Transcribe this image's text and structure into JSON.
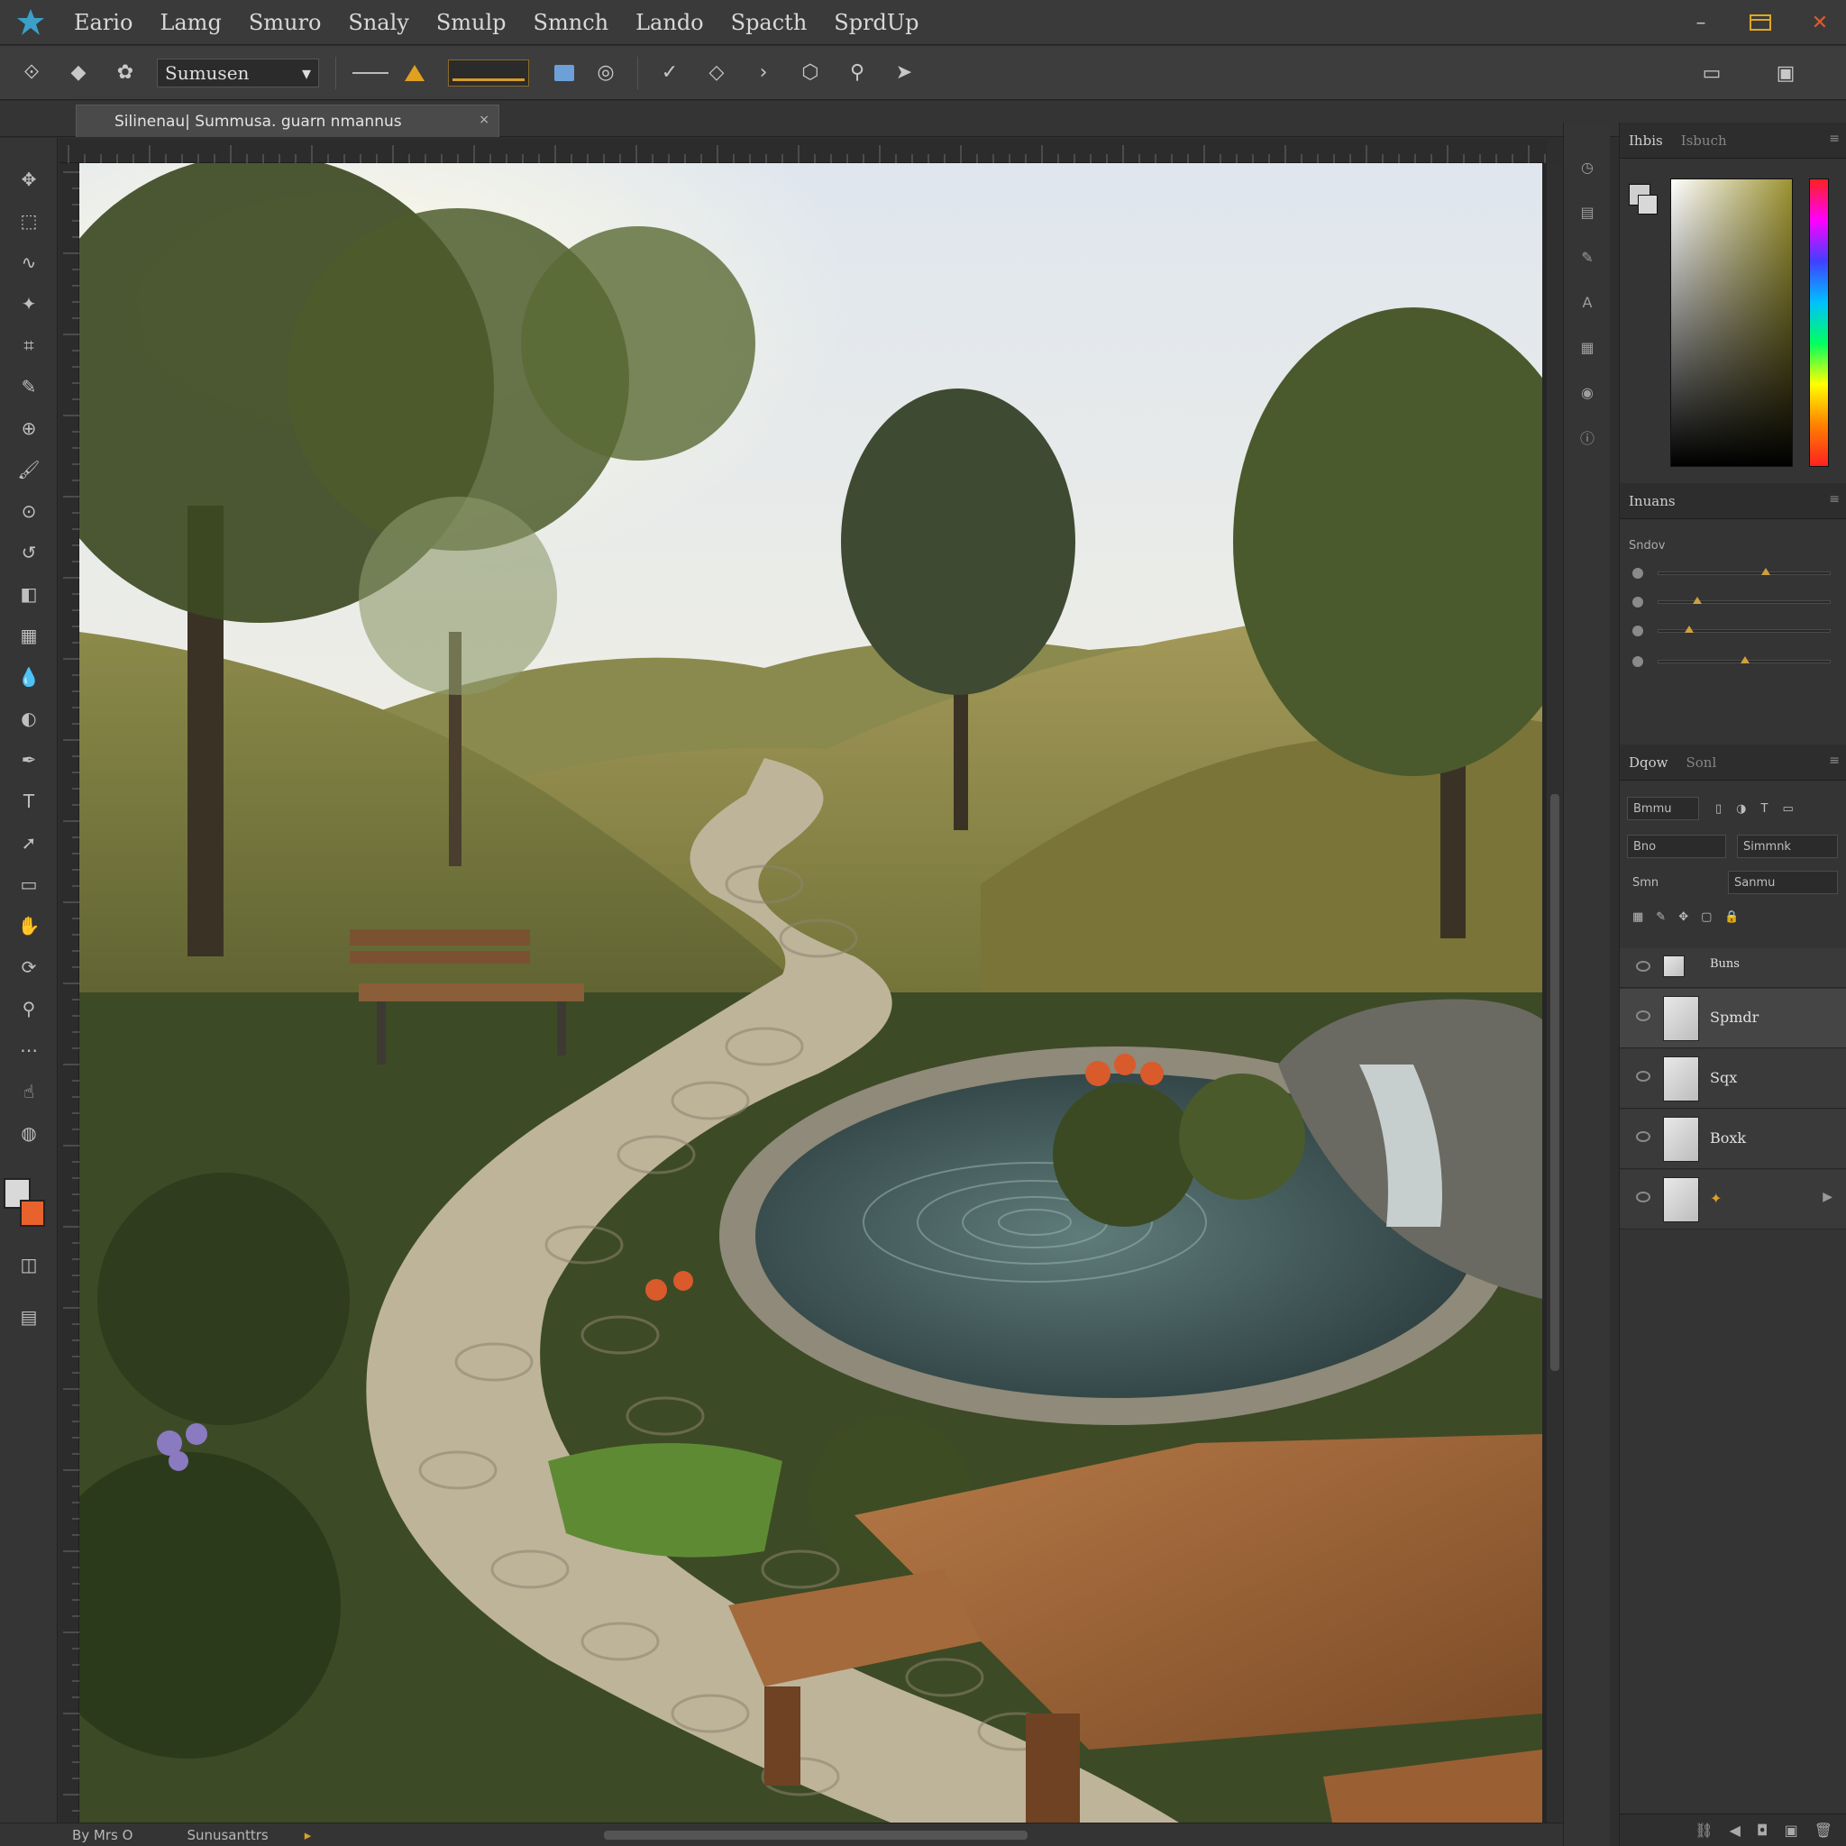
{
  "menu": {
    "items": [
      "Eario",
      "Lamg",
      "Smuro",
      "Snaly",
      "Smulp",
      "Smnch",
      "Lando",
      "Spacth",
      "SprdUp"
    ]
  },
  "options_bar": {
    "preset_label": "Sumusen",
    "preset_dropdown_glyph": "▾"
  },
  "document": {
    "tab_title": "Silinenau| Summusa. guarn nmannus",
    "tab_close": "×"
  },
  "panels": {
    "color_tabs": [
      "Ihbis",
      "Isbuch"
    ],
    "adjustments_tab": "Inuans",
    "adjustments_label": "Sndov",
    "layers_tabs": [
      "Dqow",
      "Sonl"
    ],
    "layers_filter_label": "Bmmu",
    "layers_blend": "Bno",
    "layers_opacity": "Simmnk",
    "layers_lock": "Smn",
    "layers_fill": "Sanmu",
    "layers": [
      {
        "name": "Buns",
        "selected": false
      },
      {
        "name": "Spmdr",
        "selected": true
      },
      {
        "name": "Sqx",
        "selected": false
      },
      {
        "name": "Boxk",
        "selected": false
      },
      {
        "name": "",
        "selected": false
      }
    ]
  },
  "status": {
    "zoom": "By Mrs O",
    "info": "Sunusanttrs"
  },
  "colors": {
    "foreground": "#d9d9d9",
    "background": "#e8622e",
    "accent": "#d8a02a"
  },
  "icons": {
    "logo": "app-logo",
    "minimize": "minimize-icon",
    "maximize": "maximize-icon",
    "close": "close-icon"
  }
}
